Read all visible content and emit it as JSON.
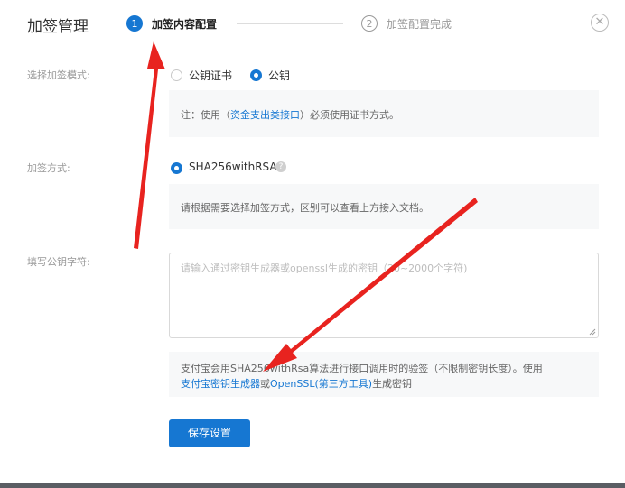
{
  "header": {
    "title": "加签管理",
    "steps": [
      {
        "number": "1",
        "label": "加签内容配置",
        "state": "active"
      },
      {
        "number": "2",
        "label": "加签配置完成",
        "state": "inactive"
      }
    ],
    "close_icon": "close-circle-icon"
  },
  "mode": {
    "label": "选择加签模式:",
    "options": [
      {
        "label": "公钥证书",
        "selected": false
      },
      {
        "label": "公钥",
        "selected": true
      }
    ],
    "note_prefix": "注：使用（",
    "note_link": "资金支出类接口",
    "note_suffix": "）必须使用证书方式。"
  },
  "method": {
    "label": "加签方式:",
    "option": "SHA256withRSA",
    "help_icon": "question-icon",
    "note": "请根据需要选择加签方式，区别可以查看上方接入文档。"
  },
  "pubkey": {
    "label": "填写公钥字符:",
    "placeholder": "请输入通过密钥生成器或openssl生成的密钥（20~2000个字符)",
    "info_line1": "支付宝会用SHA256withRsa算法进行接口调用时的验签（不限制密钥长度）。使用",
    "link1": "支付宝密钥生成器",
    "info_or": "或",
    "link2": "OpenSSL(第三方工具)",
    "info_end": "生成密钥"
  },
  "save_label": "保存设置",
  "colors": {
    "accent": "#1677d2",
    "annotation": "#e8231f",
    "note_bg": "#f7f8f9"
  }
}
